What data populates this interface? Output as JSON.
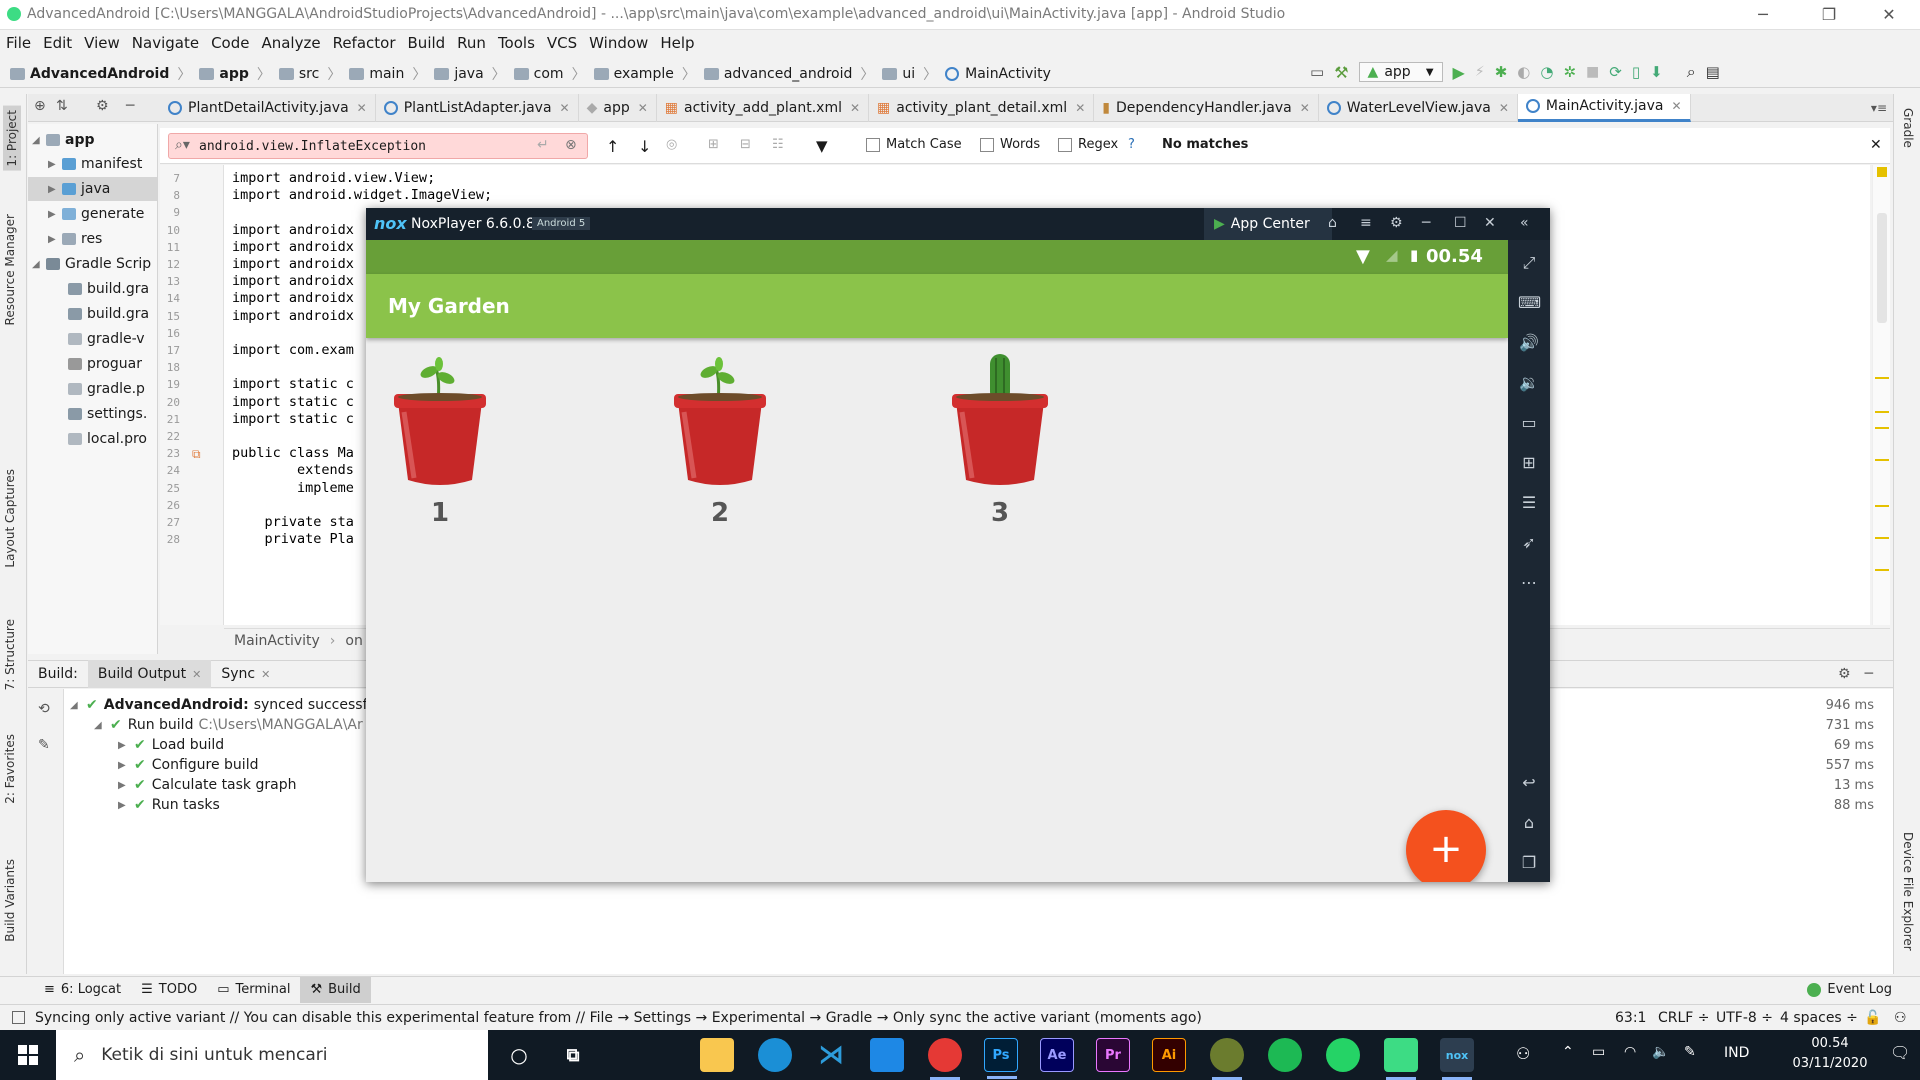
{
  "window": {
    "title": "AdvancedAndroid [C:\\Users\\MANGGALA\\AndroidStudioProjects\\AdvancedAndroid] - ...\\app\\src\\main\\java\\com\\example\\advanced_android\\ui\\MainActivity.java [app] - Android Studio"
  },
  "menu": [
    "File",
    "Edit",
    "View",
    "Navigate",
    "Code",
    "Analyze",
    "Refactor",
    "Build",
    "Run",
    "Tools",
    "VCS",
    "Window",
    "Help"
  ],
  "breadcrumbs": [
    "AdvancedAndroid",
    "app",
    "src",
    "main",
    "java",
    "com",
    "example",
    "advanced_android",
    "ui",
    "MainActivity"
  ],
  "run_config": "app",
  "tabs": [
    {
      "label": "PlantDetailActivity.java"
    },
    {
      "label": "PlantListAdapter.java"
    },
    {
      "label": "app"
    },
    {
      "label": "activity_add_plant.xml"
    },
    {
      "label": "activity_plant_detail.xml"
    },
    {
      "label": "DependencyHandler.java"
    },
    {
      "label": "WaterLevelView.java"
    },
    {
      "label": "MainActivity.java"
    }
  ],
  "project_tree": [
    {
      "label": "app",
      "depth": 0
    },
    {
      "label": "manifest",
      "depth": 1
    },
    {
      "label": "java",
      "depth": 1
    },
    {
      "label": "generate",
      "depth": 1
    },
    {
      "label": "res",
      "depth": 1
    },
    {
      "label": "Gradle Scrip",
      "depth": 0
    },
    {
      "label": "build.gra",
      "depth": 1
    },
    {
      "label": "build.gra",
      "depth": 1
    },
    {
      "label": "gradle-v",
      "depth": 1
    },
    {
      "label": "proguar",
      "depth": 1
    },
    {
      "label": "gradle.p",
      "depth": 1
    },
    {
      "label": "settings.",
      "depth": 1
    },
    {
      "label": "local.pro",
      "depth": 1
    }
  ],
  "search": {
    "value": "android.view.InflateException",
    "match_case": "Match Case",
    "words": "Words",
    "regex": "Regex",
    "help": "?",
    "result": "No matches"
  },
  "code_lines": [
    {
      "n": "7",
      "text": "import android.view.View;"
    },
    {
      "n": "8",
      "text": "import android.widget.ImageView;"
    },
    {
      "n": "9",
      "text": ""
    },
    {
      "n": "10",
      "text": "import androidx"
    },
    {
      "n": "11",
      "text": "import androidx"
    },
    {
      "n": "12",
      "text": "import androidx"
    },
    {
      "n": "13",
      "text": "import androidx"
    },
    {
      "n": "14",
      "text": "import androidx"
    },
    {
      "n": "15",
      "text": "import androidx"
    },
    {
      "n": "16",
      "text": ""
    },
    {
      "n": "17",
      "text": "import com.exam"
    },
    {
      "n": "18",
      "text": ""
    },
    {
      "n": "19",
      "text": "import static c"
    },
    {
      "n": "20",
      "text": "import static c"
    },
    {
      "n": "21",
      "text": "import static c"
    },
    {
      "n": "22",
      "text": ""
    },
    {
      "n": "23",
      "text": "public class Ma"
    },
    {
      "n": "24",
      "text": "        extends"
    },
    {
      "n": "25",
      "text": "        impleme"
    },
    {
      "n": "26",
      "text": ""
    },
    {
      "n": "27",
      "text": "    private sta"
    },
    {
      "n": "28",
      "text": "    private Pla"
    }
  ],
  "editor_breadcrumb": [
    "MainActivity",
    "on"
  ],
  "build": {
    "label": "Build:",
    "tabs": [
      "Build Output",
      "Sync"
    ],
    "items": [
      {
        "label": "AdvancedAndroid:",
        "suffix": "synced successfull",
        "time": "946 ms",
        "depth": 0
      },
      {
        "label": "Run build",
        "suffix": "C:\\Users\\MANGGALA\\Ar",
        "time": "731 ms",
        "depth": 1
      },
      {
        "label": "Load build",
        "suffix": "",
        "time": "69 ms",
        "depth": 2
      },
      {
        "label": "Configure build",
        "suffix": "",
        "time": "557 ms",
        "depth": 2
      },
      {
        "label": "Calculate task graph",
        "suffix": "",
        "time": "13 ms",
        "depth": 2
      },
      {
        "label": "Run tasks",
        "suffix": "",
        "time": "88 ms",
        "depth": 2
      }
    ]
  },
  "left_strip": [
    "1: Project",
    "Resource Manager",
    "Layout Captures",
    "7: Structure",
    "2: Favorites",
    "Build Variants"
  ],
  "right_strip": [
    "Gradle",
    "Device File Explorer"
  ],
  "tool_windows": [
    "6: Logcat",
    "TODO",
    "Terminal",
    "Build"
  ],
  "event_log": "Event Log",
  "status": {
    "message": "Syncing only active variant // You can disable this experimental feature from // File → Settings → Experimental → Gradle → Only sync the active variant (moments ago)",
    "position": "63:1",
    "line_sep": "CRLF",
    "encoding": "UTF-8",
    "indent": "4 spaces"
  },
  "nox": {
    "logo": "nox",
    "title": "NoxPlayer 6.6.0.8",
    "android_badge": "Android 5",
    "app_center": "App Center",
    "clock": "00.54",
    "app_title": "My Garden",
    "plants": [
      {
        "num": "1",
        "type": "sprout"
      },
      {
        "num": "2",
        "type": "sprout"
      },
      {
        "num": "3",
        "type": "cactus"
      }
    ],
    "fab": "+"
  },
  "taskbar": {
    "search_placeholder": "Ketik di sini untuk mencari",
    "apps": [
      "File Explorer",
      "Edge",
      "VS Code",
      "Mail",
      "Chrome",
      "Ps",
      "Ae",
      "Pr",
      "Ai",
      "Android Studio",
      "Spotify",
      "WhatsApp",
      "Android",
      "Nox"
    ],
    "lang": "IND",
    "time": "00.54",
    "date": "03/11/2020"
  },
  "colors": {
    "app_green_dark": "#689f38",
    "app_green": "#8bc34a",
    "fab": "#f4511e",
    "pot_red": "#c62828",
    "ide_accent": "#4083c9"
  }
}
